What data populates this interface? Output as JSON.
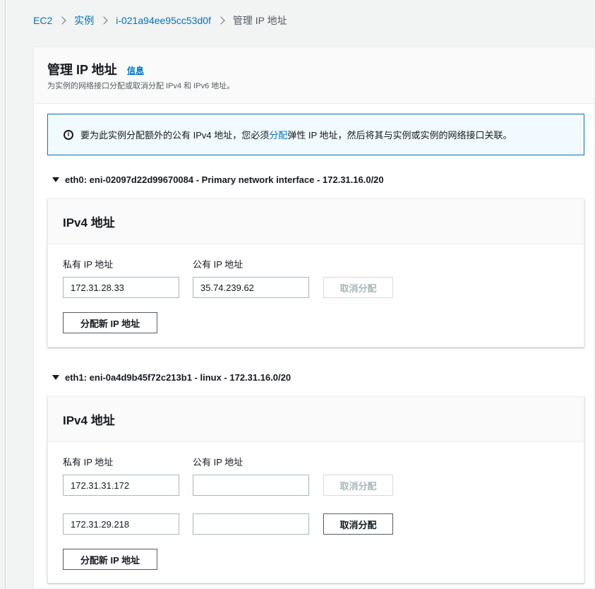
{
  "breadcrumb": {
    "items": [
      "EC2",
      "实例",
      "i-021a94ee95cc53d0f"
    ],
    "current": "管理 IP 地址"
  },
  "header": {
    "title": "管理 IP 地址",
    "info": "信息",
    "description": "为实例的网络接口分配或取消分配 IPv4 和 IPv6 地址。"
  },
  "alert": {
    "icon": "info-icon",
    "text_before": "要为此实例分配额外的公有 IPv4 地址，您必须",
    "link": "分配",
    "text_after": "弹性 IP 地址，然后将其与实例或实例的网络接口关联。"
  },
  "interfaces": [
    {
      "title": "eth0: eni-02097d22d99670084 - Primary network interface - 172.31.16.0/20",
      "card_title": "IPv4 地址",
      "private_label": "私有 IP 地址",
      "public_label": "公有 IP 地址",
      "rows": [
        {
          "private": "172.31.28.33",
          "public": "35.74.239.62",
          "unassign": "取消分配",
          "unassign_disabled": true
        }
      ],
      "assign_button": "分配新 IP 地址"
    },
    {
      "title": "eth1: eni-0a4d9b45f72c213b1 - linux - 172.31.16.0/20",
      "card_title": "IPv4 地址",
      "private_label": "私有 IP 地址",
      "public_label": "公有 IP 地址",
      "rows": [
        {
          "private": "172.31.31.172",
          "public": "",
          "unassign": "取消分配",
          "unassign_disabled": true
        },
        {
          "private": "172.31.29.218",
          "public": "",
          "unassign": "取消分配",
          "unassign_disabled": false
        }
      ],
      "assign_button": "分配新 IP 地址"
    }
  ]
}
